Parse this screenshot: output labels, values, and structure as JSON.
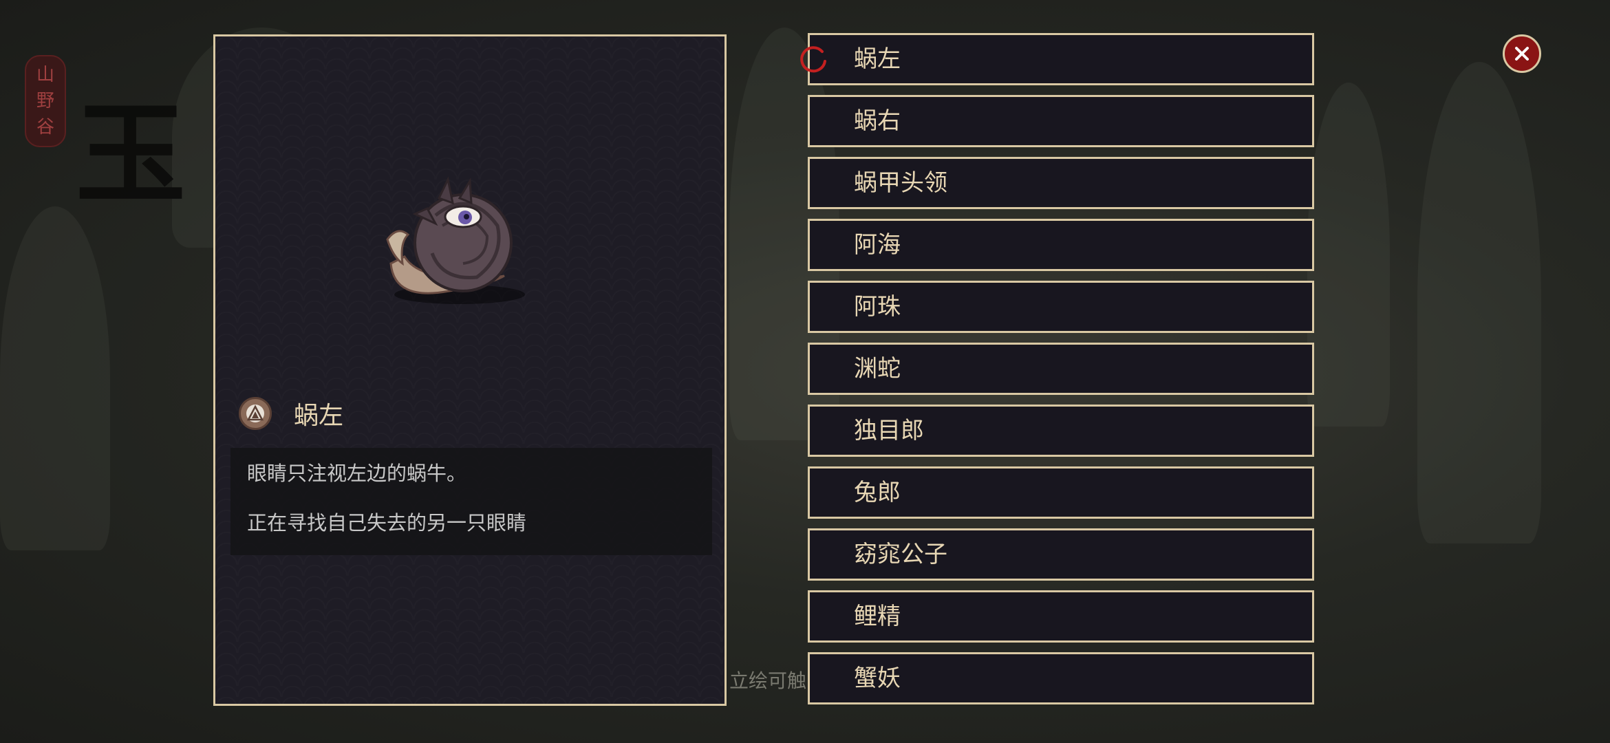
{
  "background": {
    "seal_text": [
      "山",
      "野",
      "谷"
    ],
    "title_glyph": "玉",
    "hint_text": "立绘可触"
  },
  "detail": {
    "name": "蜗左",
    "icon": "sect-emblem-icon",
    "description": [
      "眼睛只注视左边的蜗牛。",
      "正在寻找自己失去的另一只眼睛"
    ]
  },
  "character_list": {
    "selected_index": 0,
    "items": [
      "蜗左",
      "蜗右",
      "蜗甲头领",
      "阿海",
      "阿珠",
      "渊蛇",
      "独目郎",
      "兔郎",
      "窈窕公子",
      "鲤精",
      "蟹妖"
    ]
  },
  "close_icon": "close-icon",
  "colors": {
    "border_gold": "#d9c8a3",
    "text_gold": "#e8d7b4",
    "accent_red": "#8a1414"
  }
}
